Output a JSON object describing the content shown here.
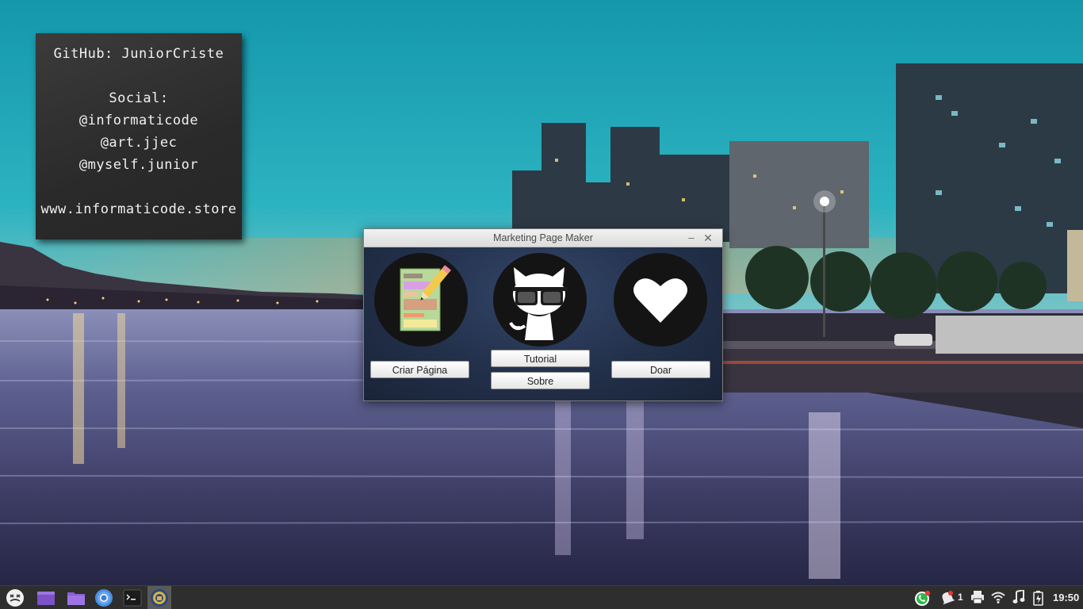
{
  "desktop_note": {
    "github": "GitHub: JuniorCriste",
    "social_heading": "Social:",
    "handles": [
      "@informaticode",
      "@art.jjec",
      "@myself.junior"
    ],
    "website": "www.informaticode.store"
  },
  "window": {
    "title": "Marketing Page Maker",
    "minimize_label": "–",
    "close_label": "✕",
    "icons": [
      "page-editor-icon",
      "github-octocat-icon",
      "heart-icon"
    ],
    "buttons": {
      "create_page": "Criar Página",
      "tutorial": "Tutorial",
      "about": "Sobre",
      "donate": "Doar"
    }
  },
  "taskbar": {
    "launchers": [
      "menu-icon",
      "workspace-icon",
      "files-icon",
      "chrome-icon",
      "terminal-icon",
      "app-icon"
    ],
    "tray": {
      "notification_count": "1",
      "clock": "19:50",
      "icons": [
        "whatsapp-icon",
        "notification-icon",
        "printer-icon",
        "wifi-icon",
        "music-icon",
        "battery-icon"
      ]
    }
  },
  "colors": {
    "sky_top": "#1aa6b8",
    "window_bg": "#22304a",
    "taskbar_bg": "#2e2e2e",
    "workspace_purple": "#7b52c7"
  }
}
